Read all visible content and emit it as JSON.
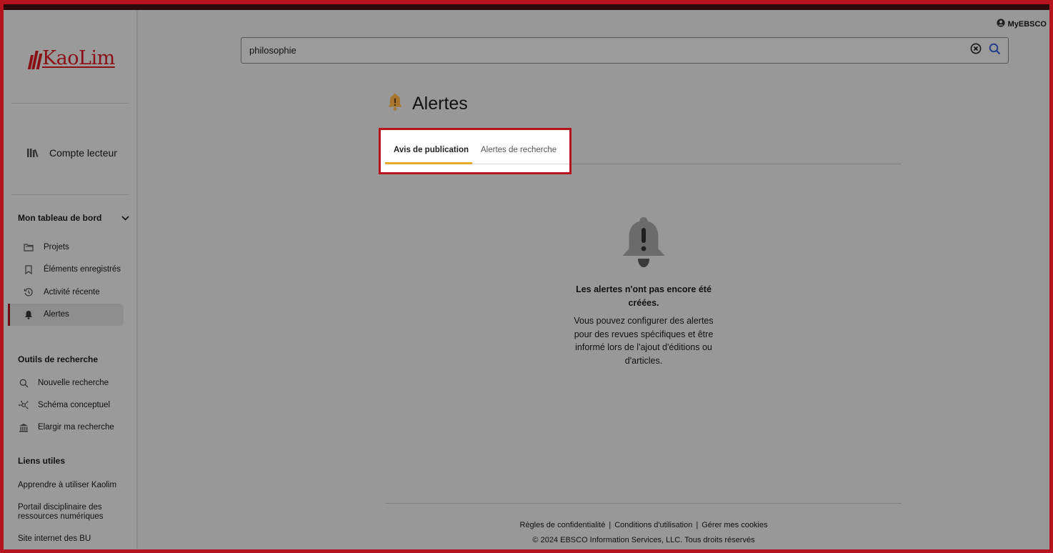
{
  "brand": {
    "logo_text": "KaoLim",
    "accent_color": "#8a1016",
    "highlight_color": "#b5141e"
  },
  "header": {
    "account_label": "MyEBSCO"
  },
  "search": {
    "value": "philosophie",
    "clear_icon": "clear-circle-icon",
    "submit_icon": "search-icon"
  },
  "sidebar": {
    "account": {
      "label": "Compte lecteur",
      "icon": "books-icon"
    },
    "dashboard": {
      "title": "Mon tableau de bord",
      "items": [
        {
          "label": "Projets",
          "icon": "folder-icon"
        },
        {
          "label": "Éléments enregistrés",
          "icon": "bookmark-icon"
        },
        {
          "label": "Activité récente",
          "icon": "history-icon"
        },
        {
          "label": "Alertes",
          "icon": "bell-icon",
          "active": true
        }
      ]
    },
    "tools": {
      "title": "Outils de recherche",
      "items": [
        {
          "label": "Nouvelle recherche",
          "icon": "search-icon"
        },
        {
          "label": "Schéma conceptuel",
          "icon": "concept-map-icon"
        },
        {
          "label": "Elargir ma recherche",
          "icon": "library-icon"
        }
      ]
    },
    "links": {
      "title": "Liens utiles",
      "items": [
        {
          "label": "Apprendre à utiliser Kaolim"
        },
        {
          "label": "Portail disciplinaire des ressources numériques"
        },
        {
          "label": "Site internet des BU"
        }
      ]
    }
  },
  "main": {
    "title": "Alertes",
    "tabs": [
      {
        "label": "Avis de publication",
        "active": true
      },
      {
        "label": "Alertes de recherche",
        "active": false
      }
    ],
    "empty_state": {
      "heading": "Les alertes n'ont pas encore été créées.",
      "body": "Vous pouvez configurer des alertes pour des revues spécifiques et être informé lors de l'ajout d'éditions ou d'articles."
    }
  },
  "footer": {
    "links": [
      "Règles de confidentialité",
      "Conditions d'utilisation",
      "Gérer mes cookies"
    ],
    "copyright": "© 2024 EBSCO Information Services, LLC. Tous droits réservés"
  }
}
